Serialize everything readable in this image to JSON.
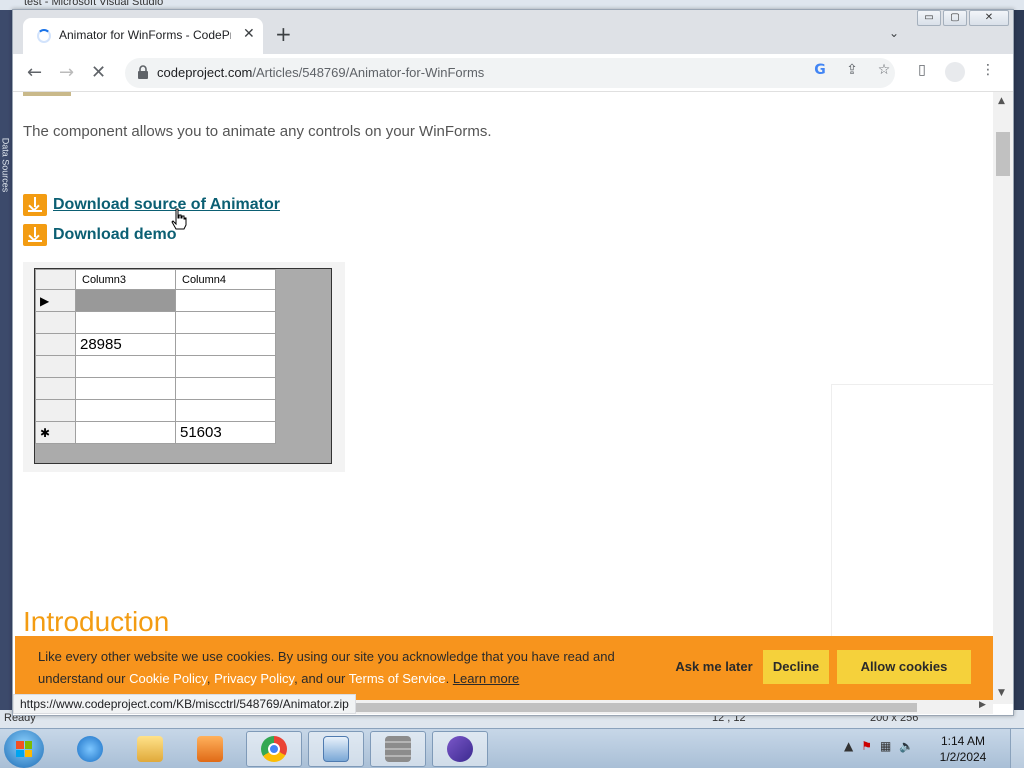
{
  "behind_window": {
    "title": "test - Microsoft Visual Studio",
    "side_label": "Data Sources",
    "status_ready": "Ready",
    "status_pos": "12 , 12",
    "status_size": "200 x 256"
  },
  "browser": {
    "tab": {
      "title": "Animator for WinForms - CodeProject"
    },
    "window_buttons": {
      "minimize": "▭",
      "maximize": "▢",
      "close": "✕"
    },
    "url": {
      "host": "codeproject.com",
      "path": "/Articles/548769/Animator-for-WinForms"
    },
    "status_url": "https://www.codeproject.com/KB/miscctrl/548769/Animator.zip"
  },
  "page": {
    "lead": "The component allows you to animate any controls on your WinForms.",
    "downloads": [
      {
        "label": "Download source of Animator"
      },
      {
        "label": "Download demo"
      }
    ],
    "grid": {
      "headers": [
        "Column3",
        "Column4"
      ],
      "rows": [
        {
          "marker": "▶",
          "c3": "",
          "c4": ""
        },
        {
          "marker": "",
          "c3": "",
          "c4": ""
        },
        {
          "marker": "",
          "c3": "28985",
          "c4": ""
        },
        {
          "marker": "",
          "c3": "",
          "c4": ""
        },
        {
          "marker": "",
          "c3": "",
          "c4": ""
        },
        {
          "marker": "",
          "c3": "",
          "c4": ""
        },
        {
          "marker": "✱",
          "c3": "",
          "c4": "51603"
        }
      ]
    },
    "intro_heading": "Introduction"
  },
  "cookie": {
    "msg_before": "Like every other website we use cookies. By using our site you acknowledge that you have read and understand our ",
    "cookie_policy": "Cookie Policy",
    "sep1": ", ",
    "privacy_policy": "Privacy Policy",
    "sep2": ", and our ",
    "terms": "Terms of Service",
    "sep3": ". ",
    "learn_more": "Learn more",
    "ask_later": "Ask me later",
    "decline": "Decline",
    "allow": "Allow cookies"
  },
  "taskbar": {
    "time": "1:14 AM",
    "date": "1/2/2024"
  },
  "colors": {
    "accent_orange": "#f39c12",
    "cookie_bg": "#f7941d",
    "button_yellow": "#f5d13b",
    "link_teal": "#0b5f73"
  }
}
